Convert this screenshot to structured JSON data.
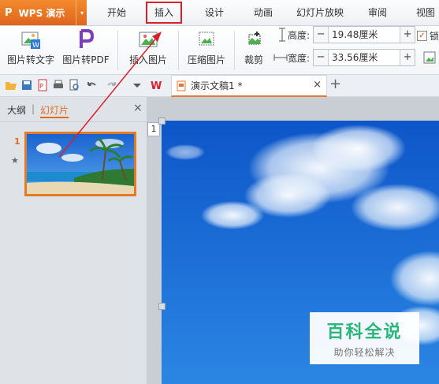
{
  "app": {
    "logo": "P",
    "title": "WPS 演示",
    "menu_caret": "▾"
  },
  "tabs": [
    {
      "label": "开始"
    },
    {
      "label": "插入",
      "active": true
    },
    {
      "label": "设计"
    },
    {
      "label": "动画"
    },
    {
      "label": "幻灯片放映"
    },
    {
      "label": "审阅"
    },
    {
      "label": "视图"
    }
  ],
  "ribbon": {
    "pic_to_text": "图片转文字",
    "pic_to_pdf": "图片转PDF",
    "insert_picture": "插入图片",
    "compress_picture": "压缩图片",
    "crop": "裁剪",
    "height_label": "高度:",
    "height_value": "19.48厘米",
    "width_label": "宽度:",
    "width_value": "33.56厘米",
    "lock_label": "锁",
    "minus": "−",
    "plus": "+"
  },
  "doc_tab": {
    "label": "演示文稿1 *",
    "close": "×",
    "new": "+"
  },
  "panel": {
    "tab_outline": "大纲",
    "tab_divider": "|",
    "tab_slides": "幻灯片",
    "close": "×",
    "slide_number": "1",
    "slide_star": "★"
  },
  "canvas": {
    "ruler_number": "1"
  },
  "watermark": {
    "title": "百科全说",
    "subtitle": "助你轻松解决"
  },
  "colors": {
    "accent_orange": "#e6772e",
    "highlight_red": "#d9212b",
    "watermark_green": "#2ab57a",
    "sky_blue": "#1a6fd8"
  },
  "icons": [
    "save-icon",
    "print-icon",
    "undo-icon",
    "redo-icon",
    "wps-logo-icon",
    "picture-icon",
    "crop-icon",
    "lock-checkbox-icon"
  ]
}
